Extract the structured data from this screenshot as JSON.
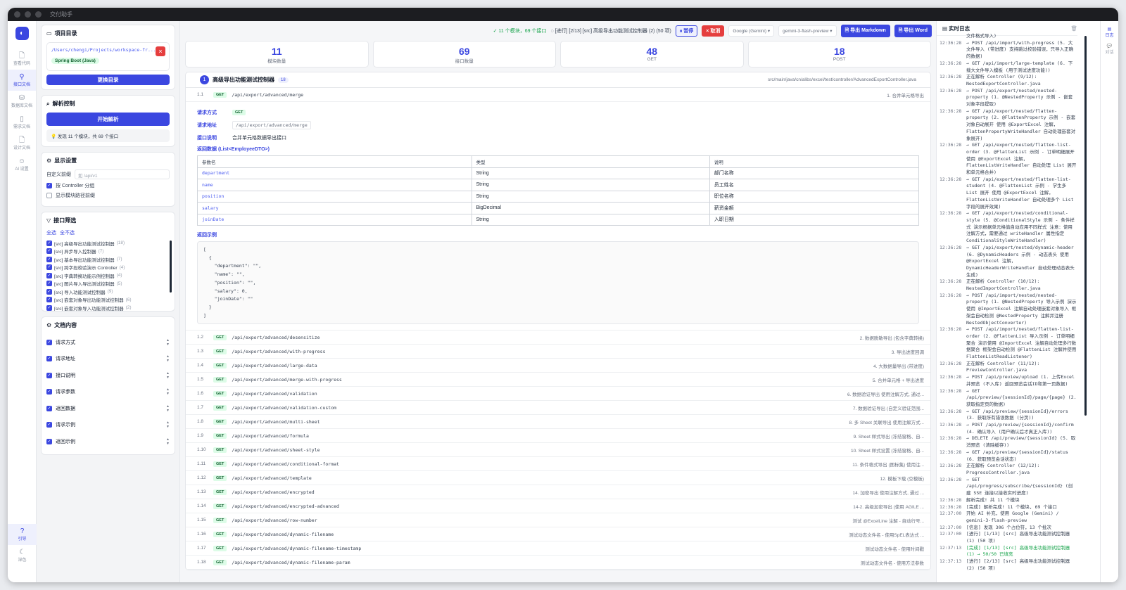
{
  "app": {
    "title": "交付助手"
  },
  "rail": {
    "items": [
      {
        "icon": "file-code-icon",
        "label": "查看代码"
      },
      {
        "icon": "plug-icon",
        "label": "接口文档"
      },
      {
        "icon": "database-icon",
        "label": "数据库文档"
      },
      {
        "icon": "book-icon",
        "label": "需求文档"
      },
      {
        "icon": "design-doc-icon",
        "label": "设计文档"
      },
      {
        "icon": "robot-icon",
        "label": "AI 设置"
      }
    ],
    "bottom": [
      {
        "icon": "help-icon",
        "label": "引导"
      },
      {
        "icon": "moon-icon",
        "label": "深色"
      }
    ]
  },
  "project": {
    "title": "项目目录",
    "path": "/Users/chengi/Projects/workspace-fr...",
    "framework": "Spring Boot (Java)",
    "change_btn": "更换目录"
  },
  "parse": {
    "title": "解析控制",
    "start_btn": "开始解析",
    "hint": "发现 11 个模块，共 69 个接口"
  },
  "display": {
    "title": "显示设置",
    "prefix_label": "自定义前缀",
    "prefix_placeholder": "如 /api/v1",
    "group_by_controller": "按 Controller 分组",
    "show_module_prefix": "显示模块路径前缀"
  },
  "filter": {
    "title": "接口筛选",
    "select_all": "全选",
    "select_none": "全不选",
    "items": [
      {
        "label": "[src] 高级导出功能测试控制器",
        "count": "(18)"
      },
      {
        "label": "[src] 异步导入控制器",
        "count": "(7)"
      },
      {
        "label": "[src] 基本导出功能测试控制器",
        "count": "(7)"
      },
      {
        "label": "[src] 跨字段校验演示 Controller",
        "count": "(4)"
      },
      {
        "label": "[src] 字典转换功能示例控制器",
        "count": "(4)"
      },
      {
        "label": "[src] 图片导入导出测试控制器",
        "count": "(5)"
      },
      {
        "label": "[src] 导入功能测试控制器",
        "count": "(9)"
      },
      {
        "label": "[src] 嵌套对象导出功能测试控制器",
        "count": "(6)"
      },
      {
        "label": "[src] 嵌套对象导入功能测试控制器",
        "count": "(2)"
      }
    ]
  },
  "doc_content": {
    "title": "文档内容",
    "items": [
      "请求方式",
      "请求地址",
      "接口说明",
      "请求参数",
      "返回数据",
      "请求示例",
      "返回示例"
    ]
  },
  "topbar": {
    "status": "✓ 11 个模块，69 个接口",
    "progress": "[进行] [2/13] [src] 高级导出功能测试控制器 (2) (50 项)",
    "pause": "⏸ 暂停",
    "cancel": "× 取消",
    "provider": "Google (Gemini)",
    "model": "gemini-3-flash-preview",
    "export_md": "导出 Markdown",
    "export_word": "导出 Word"
  },
  "stats": [
    {
      "value": "11",
      "label": "模块数量"
    },
    {
      "value": "69",
      "label": "接口数量"
    },
    {
      "value": "48",
      "label": "GET"
    },
    {
      "value": "18",
      "label": "POST"
    }
  ],
  "controller": {
    "index": "1",
    "name": "高级导出功能测试控制器",
    "count": "18",
    "source": "src/main/java/cn/alibs/excel/test/controller/AdvancedExportController.java"
  },
  "first_endpoint": {
    "index": "1.1",
    "method": "GET",
    "url": "/api/export/advanced/merge",
    "desc": "1. 合并单元格导出",
    "labels": {
      "method": "请求方式",
      "url": "请求地址",
      "desc": "接口说明"
    },
    "desc_value": "合并单元格数据导出接口",
    "return_title": "返回数据 (List<EmployeeDTO>)",
    "table_headers": [
      "参数名",
      "类型",
      "说明"
    ],
    "table_rows": [
      [
        "department",
        "String",
        "部门名称"
      ],
      [
        "name",
        "String",
        "员工姓名"
      ],
      [
        "position",
        "String",
        "职位名称"
      ],
      [
        "salary",
        "BigDecimal",
        "薪资金额"
      ],
      [
        "joinDate",
        "String",
        "入职日期"
      ]
    ],
    "example_title": "返回示例",
    "example": "[\n  {\n    \"department\": \"\",\n    \"name\": \"\",\n    \"position\": \"\",\n    \"salary\": 0,\n    \"joinDate\": \"\"\n  }\n]"
  },
  "endpoints": [
    {
      "index": "1.2",
      "method": "GET",
      "url": "/api/export/advanced/desensitize",
      "desc": "2. 数据脱敏导出 (包含字典转换)"
    },
    {
      "index": "1.3",
      "method": "GET",
      "url": "/api/export/advanced/with-progress",
      "desc": "3. 导出进度回调"
    },
    {
      "index": "1.4",
      "method": "GET",
      "url": "/api/export/advanced/large-data",
      "desc": "4. 大数据量导出 (带进度)"
    },
    {
      "index": "1.5",
      "method": "GET",
      "url": "/api/export/advanced/merge-with-progress",
      "desc": "5. 合并单元格 + 导出进度"
    },
    {
      "index": "1.6",
      "method": "GET",
      "url": "/api/export/advanced/validation",
      "desc": "6. 数据验证导出 使用注解方式, 通过..."
    },
    {
      "index": "1.7",
      "method": "GET",
      "url": "/api/export/advanced/validation-custom",
      "desc": "7. 数据验证导出 (自定义验证范围..."
    },
    {
      "index": "1.8",
      "method": "GET",
      "url": "/api/export/advanced/multi-sheet",
      "desc": "8. 多 Sheet 关联导出 使用注解方式..."
    },
    {
      "index": "1.9",
      "method": "GET",
      "url": "/api/export/advanced/formula",
      "desc": "9. Sheet 样式导出 (冻结窗格、自..."
    },
    {
      "index": "1.10",
      "method": "GET",
      "url": "/api/export/advanced/sheet-style",
      "desc": "10. Sheet 样式设置 (冻结窗格、自..."
    },
    {
      "index": "1.11",
      "method": "GET",
      "url": "/api/export/advanced/conditional-format",
      "desc": "11. 条件格式导出 (图标集) 使用注..."
    },
    {
      "index": "1.12",
      "method": "GET",
      "url": "/api/export/advanced/template",
      "desc": "12. 模板下载 (空模板)"
    },
    {
      "index": "1.13",
      "method": "GET",
      "url": "/api/export/advanced/encrypted",
      "desc": "14. 加密导出 使用注解方式, 通过 ..."
    },
    {
      "index": "1.14",
      "method": "GET",
      "url": "/api/export/advanced/encrypted-advanced",
      "desc": "14-2. 高级加密导出 (使用 AGILE ..."
    },
    {
      "index": "1.15",
      "method": "GET",
      "url": "/api/export/advanced/row-number",
      "desc": "测试 @ExcelLine 注解 - 自动行号..."
    },
    {
      "index": "1.16",
      "method": "GET",
      "url": "/api/export/advanced/dynamic-filename",
      "desc": "测试动态文件名 - 使用SpEL表达式 ..."
    },
    {
      "index": "1.17",
      "method": "GET",
      "url": "/api/export/advanced/dynamic-filename-timestamp",
      "desc": "测试动态文件名 - 使用时间戳"
    },
    {
      "index": "1.18",
      "method": "GET",
      "url": "/api/export/advanced/dynamic-filename-param",
      "desc": "测试动态文件名 - 使用方法参数"
    }
  ],
  "log": {
    "title": "实时日志",
    "lines": [
      {
        "ts": "",
        "text": "文件格式导入)"
      },
      {
        "ts": "12:36:28",
        "text": "→ POST /api/import/with-progress (5. 大文件导入 (带进度) 支持跳过校验错误，只导入正确的数据)"
      },
      {
        "ts": "12:36:28",
        "text": "→ GET /api/import/large-template (6. 下载大文件导入模板 (用于测试进度功能))"
      },
      {
        "ts": "12:36:28",
        "text": "正在解析 Controller (9/12): NestedExportController.java"
      },
      {
        "ts": "12:36:28",
        "text": "→ POST /api/export/nested/nested-property (1. @NestedProperty 示例 - 嵌套对象字段提取)"
      },
      {
        "ts": "12:36:28",
        "text": "→ GET /api/export/nested/flatten-property (2. @FlattenProperty 示例 - 嵌套对象自动展开 使用 @ExportExcel 注解，FlattenPropertyWriteHandler 自动处理嵌套对象展开)"
      },
      {
        "ts": "12:36:28",
        "text": "→ GET /api/export/nested/flatten-list-order (3. @FlattenList 示例 - 订单明细展开 使用 @ExportExcel 注解，FlattenListWriteHandler 自动处理 List 展开和单元格合并)"
      },
      {
        "ts": "12:36:28",
        "text": "→ GET /api/export/nested/flatten-list-student (4. @FlattenList 示例 - 学生多 List 展开 使用 @ExportExcel 注解，FlattenListWriteHandler 自动处理多个 List 字段的展开效果)"
      },
      {
        "ts": "12:36:28",
        "text": "→ GET /api/export/nested/conditional-style (5. @ConditionalStyle 示例 - 条件样式 演示根据单元格值自动应用不同样式 注意：使用注解方式，需要通过 writeHandler 属性指定 ConditionalStyleWriteHandler)"
      },
      {
        "ts": "12:36:28",
        "text": "→ GET /api/export/nested/dynamic-header (6. @DynamicHeaders 示例 - 动态表头 使用 @ExportExcel 注解，DynamicHeaderWriteHandler 自动处理动态表头生成)"
      },
      {
        "ts": "12:36:28",
        "text": "正在解析 Controller (10/12): NestedImportController.java"
      },
      {
        "ts": "12:36:28",
        "text": "→ POST /api/import/nested/nested-property (1. @NestedProperty 导入示例 演示使用 @ImportExcel 注解自动处理嵌套对象导入 框架会自动检测 @NestedProperty 注解并注册 NestedObjectConverter)"
      },
      {
        "ts": "12:36:28",
        "text": "→ POST /api/import/nested/flatten-list-order (2. @FlattenList 导入示例 - 订单明细聚合 演示使用 @ImportExcel 注解自动处理多行数据聚合 框架会自动检测 @FlattenList 注解并使用 FlattenListReadListener)"
      },
      {
        "ts": "12:36:28",
        "text": "正在解析 Controller (11/12): PreviewController.java"
      },
      {
        "ts": "12:36:28",
        "text": "→ POST /api/preview/upload (1. 上传Excel并预览 (不入库) 返回预览会话ID和第一页数据)"
      },
      {
        "ts": "12:36:28",
        "text": "→ GET /api/preview/{sessionId}/page/{page} (2. 获取指定页的数据)"
      },
      {
        "ts": "12:36:28",
        "text": "→ GET /api/preview/{sessionId}/errors (3. 获取所有错误数据 (分页))"
      },
      {
        "ts": "12:36:28",
        "text": "→ POST /api/preview/{sessionId}/confirm (4. 确认导入 (用户确认后才真正入库))"
      },
      {
        "ts": "12:36:28",
        "text": "→ DELETE /api/preview/{sessionId} (5. 取消预览 (清除缓存))"
      },
      {
        "ts": "12:36:28",
        "text": "→ GET /api/preview/{sessionId}/status (6. 获取预览会话状态)"
      },
      {
        "ts": "12:36:28",
        "text": "正在解析 Controller (12/12): ProgressController.java"
      },
      {
        "ts": "12:36:28",
        "text": "→ GET /api/progress/subscribe/{sessionId} (创建 SSE 连接以接收实时进度)"
      },
      {
        "ts": "12:36:28",
        "text": "解析完成! 共 11 个模块"
      },
      {
        "ts": "12:36:28",
        "text": "[完成] 解析完成! 11 个模块, 69 个接口"
      },
      {
        "ts": "12:37:00",
        "text": "开始 AI 补充，使用 Google (Gemini) / gemini-3-flash-preview"
      },
      {
        "ts": "12:37:00",
        "text": "[信息] 发现 306 个占位符，13 个批次"
      },
      {
        "ts": "12:37:00",
        "text": "[进行] [1/13] [src] 高级导出功能测试控制器 (1) (50 项)"
      },
      {
        "ts": "12:37:13",
        "text": "[完成] [1/13] [src] 高级导出功能测试控制器 (1) → 50/50 已填充",
        "green": true
      },
      {
        "ts": "12:37:13",
        "text": "[进行] [2/13] [src] 高级导出功能测试控制器 (2) (50 项)"
      }
    ]
  },
  "right_rail": {
    "label": "日志",
    "label2": "对话"
  }
}
